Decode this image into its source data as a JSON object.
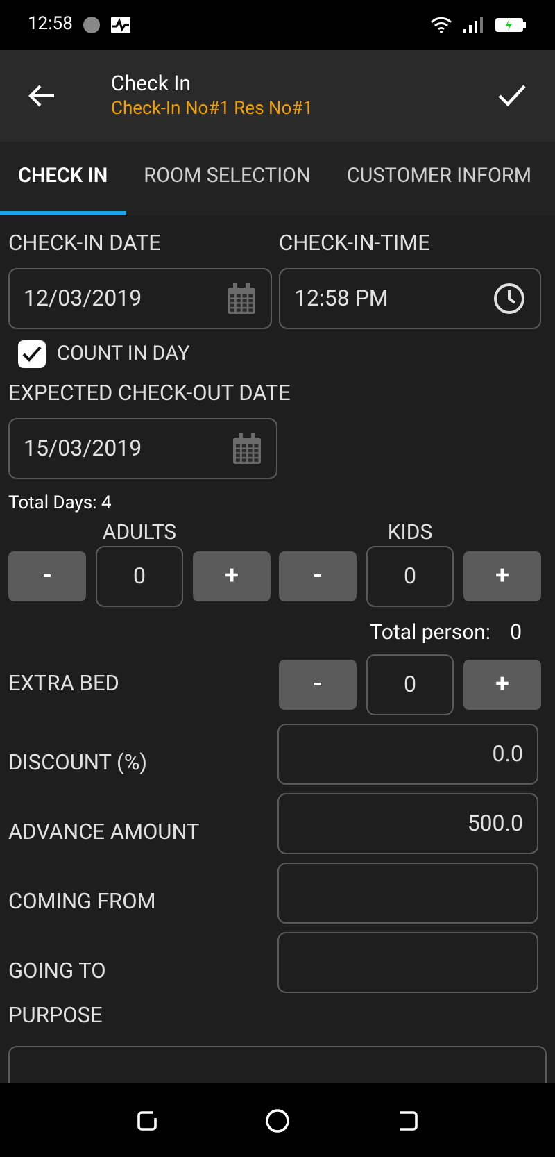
{
  "status_bar": {
    "time": "12:58"
  },
  "app_bar": {
    "title": "Check In",
    "subtitle": "Check-In No#1 Res No#1"
  },
  "tabs": [
    {
      "label": "CHECK IN",
      "selected": true
    },
    {
      "label": "ROOM SELECTION",
      "selected": false
    },
    {
      "label": "CUSTOMER INFORM",
      "selected": false
    }
  ],
  "check_in_date": {
    "label": "CHECK-IN DATE",
    "value": "12/03/2019"
  },
  "check_in_time": {
    "label": "CHECK-IN-TIME",
    "value": "12:58 PM"
  },
  "count_in_day": {
    "label": "COUNT IN DAY",
    "checked": true
  },
  "expected_check_out": {
    "label": "EXPECTED CHECK-OUT DATE",
    "value": "15/03/2019"
  },
  "total_days": "Total Days: 4",
  "counters": [
    {
      "label": "ADULTS",
      "minus": "-",
      "value": "0",
      "plus": "+"
    },
    {
      "label": "KIDS",
      "minus": "-",
      "value": "0",
      "plus": "+"
    }
  ],
  "total_person": {
    "label": "Total person:",
    "value": "0"
  },
  "extra_bed": {
    "label": "EXTRA BED",
    "minus": "-",
    "value": "0",
    "plus": "+"
  },
  "fields": [
    {
      "label": "DISCOUNT (%)",
      "value": "0.0"
    },
    {
      "label": "ADVANCE AMOUNT",
      "value": "500.0"
    },
    {
      "label": "COMING FROM"
    },
    {
      "label": "GOING TO"
    }
  ],
  "purpose": {
    "label": "PURPOSE"
  }
}
